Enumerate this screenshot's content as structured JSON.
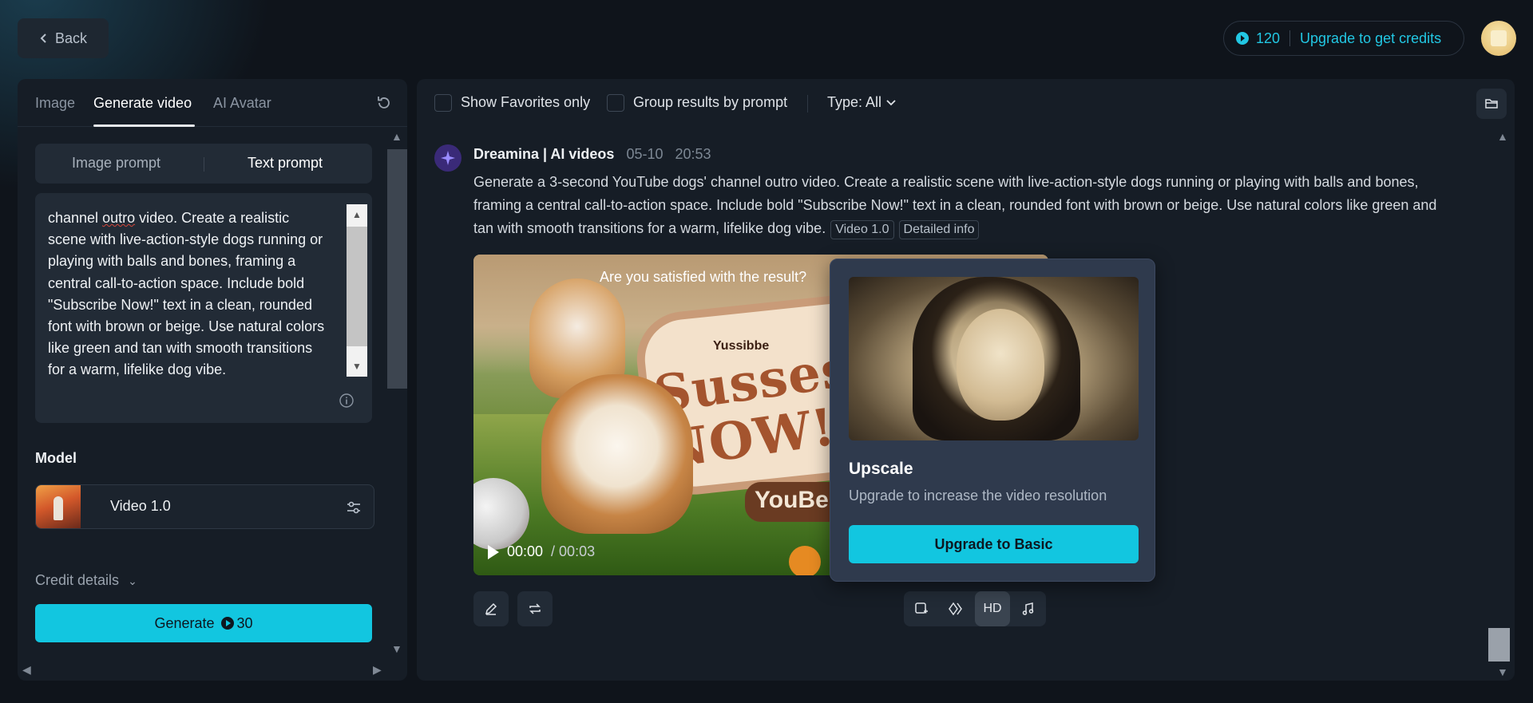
{
  "header": {
    "back_label": "Back",
    "credits": "120",
    "upgrade_label": "Upgrade to get credits"
  },
  "left_panel": {
    "tabs": [
      {
        "label": "Image"
      },
      {
        "label": "Generate video",
        "active": true
      },
      {
        "label": "AI Avatar"
      }
    ],
    "prompt_modes": {
      "image": "Image prompt",
      "text": "Text prompt",
      "selected": "Text prompt"
    },
    "prompt_lines": {
      "l1a": "channel ",
      "l1b": "outro",
      "l1c": " video. Create a realistic",
      "l2": "scene with live-action-style dogs running or",
      "l3": "playing with balls and bones, framing a",
      "l4": "central call-to-action space. Include bold",
      "l5": "\"Subscribe Now!\" text in a clean, rounded",
      "l6": "font with brown or beige. Use natural colors",
      "l7": "like green and tan with smooth transitions",
      "l8": "for a warm, lifelike dog vibe."
    },
    "model_label": "Model",
    "model_name": "Video 1.0",
    "credit_details_label": "Credit details",
    "generate_label": "Generate",
    "generate_cost": "30"
  },
  "filters": {
    "favorites_label": "Show Favorites only",
    "group_label": "Group results by prompt",
    "type_label": "Type: All"
  },
  "message": {
    "author": "Dreamina | AI videos",
    "date": "05-10",
    "time": "20:53",
    "prompt_line1": "Generate a 3-second YouTube dogs' channel outro video. Create a realistic scene with live-action-style dogs running or playing with balls and bones,",
    "prompt_line2": "framing a central call-to-action space. Include bold \"Subscribe Now!\" text in a clean, rounded font with brown or beige. Use natural colors like green and",
    "prompt_line3": "tan with smooth transitions for a warm, lifelike dog vibe.",
    "tag_model": "Video 1.0",
    "tag_info": "Detailed info"
  },
  "video": {
    "satisfied_prompt": "Are you satisfied with the result?",
    "sign_line1": "Sussesib",
    "sign_line2": "NOW!",
    "sign_small": "Yussibbe",
    "sign_badge": "YouBe",
    "current_time": "00:00",
    "duration": "/ 00:03",
    "hd_label": "HD"
  },
  "popover": {
    "title": "Upscale",
    "description": "Upgrade to increase the video resolution",
    "button_label": "Upgrade to Basic"
  },
  "colors": {
    "accent": "#12c6e0",
    "background": "#0f141b",
    "panel": "#161d26",
    "popover": "#2f3a4d"
  }
}
